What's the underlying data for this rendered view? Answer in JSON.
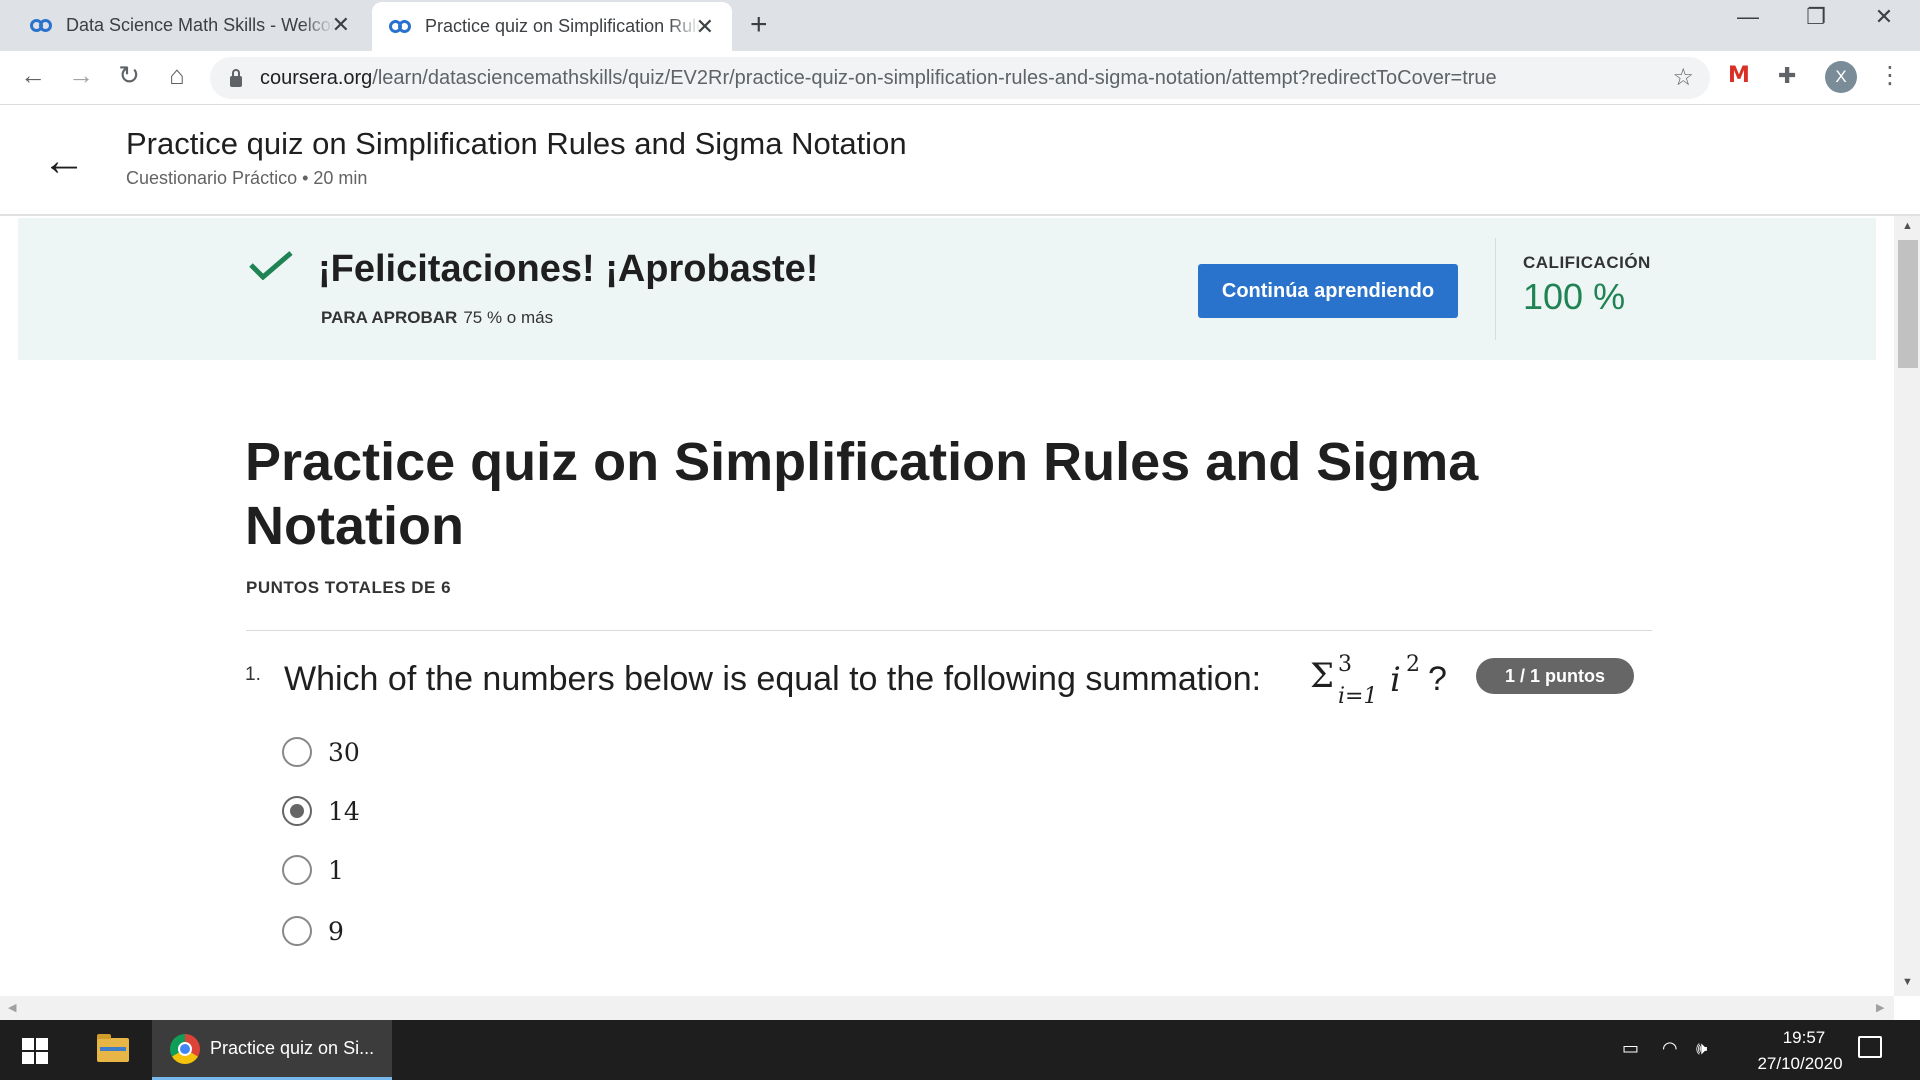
{
  "browser": {
    "tabs": [
      {
        "title": "Data Science Math Skills - Welcome",
        "active": false
      },
      {
        "title": "Practice quiz on Simplification Rules and Sigma Notation",
        "active": true
      }
    ],
    "new_tab_icon": "plus-icon",
    "url_domain": "coursera.org",
    "url_path": "/learn/datasciencemathskills/quiz/EV2Rr/practice-quiz-on-simplification-rules-and-sigma-notation/attempt?redirectToCover=true",
    "profile_initial": "X"
  },
  "header": {
    "title": "Practice quiz on Simplification Rules and Sigma Notation",
    "subtitle": "Cuestionario Práctico • 20 min"
  },
  "banner": {
    "heading": "¡Felicitaciones! ¡Aprobaste!",
    "pass_label": "PARA APROBAR",
    "pass_value": "75 % o más",
    "continue_label": "Continúa aprendiendo",
    "grade_label": "CALIFICACIÓN",
    "grade_value": "100 %",
    "accent_color": "#1f8354",
    "button_color": "#2a73cc"
  },
  "quiz": {
    "title": "Practice quiz on Simplification Rules and Sigma Notation",
    "total_points": "PUNTOS TOTALES DE 6",
    "questions": [
      {
        "number": "1.",
        "text": "Which of the numbers below is equal to the following summation:",
        "formula": {
          "symbol": "Σ",
          "upper": "3",
          "lower": "i=1",
          "term": "i",
          "exponent": "2",
          "tail": "?"
        },
        "points_badge": "1 / 1 puntos",
        "options": [
          {
            "label": "30",
            "selected": false
          },
          {
            "label": "14",
            "selected": true
          },
          {
            "label": "1",
            "selected": false
          },
          {
            "label": "9",
            "selected": false
          }
        ]
      }
    ]
  },
  "taskbar": {
    "active_app_label": "Practice quiz on Si...",
    "time": "19:57",
    "date": "27/10/2020"
  }
}
